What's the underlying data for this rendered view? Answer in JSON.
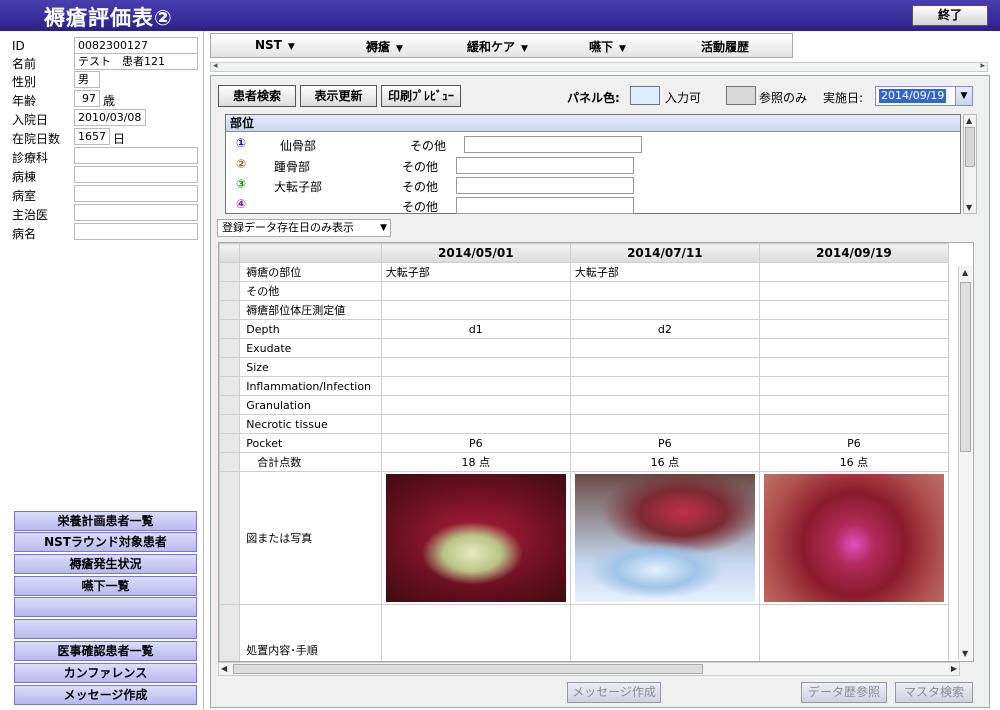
{
  "window": {
    "title": "褥瘡評価表②",
    "exit_label": "終了"
  },
  "patient": {
    "fields": [
      {
        "label": "ID",
        "value": "0082300127"
      },
      {
        "label": "名前",
        "value": "テスト　患者121"
      },
      {
        "label": "性別",
        "value": "男"
      },
      {
        "label": "年齢",
        "value": "97",
        "unit": "歳"
      },
      {
        "label": "入院日",
        "value": "2010/03/08"
      },
      {
        "label": "在院日数",
        "value": "1657",
        "unit": "日"
      },
      {
        "label": "診療科",
        "value": ""
      },
      {
        "label": "病棟",
        "value": ""
      },
      {
        "label": "病室",
        "value": ""
      },
      {
        "label": "主治医",
        "value": ""
      },
      {
        "label": "病名",
        "value": ""
      }
    ]
  },
  "left_nav": [
    "栄養計画患者一覧",
    "NSTラウンド対象患者",
    "褥瘡発生状況",
    "嚥下一覧",
    "",
    "",
    "医事確認患者一覧",
    "カンファレンス",
    "メッセージ作成"
  ],
  "menu": [
    {
      "label": "NST",
      "caret": "▼"
    },
    {
      "label": "褥瘡",
      "caret": "▼"
    },
    {
      "label": "緩和ケア",
      "caret": "▼"
    },
    {
      "label": "嚥下",
      "caret": "▼"
    },
    {
      "label": "活動履歴",
      "caret": ""
    }
  ],
  "toolbar": {
    "patient_search": "患者検索",
    "refresh": "表示更新",
    "print_preview": "印刷ﾌﾟﾚﾋﾞｭｰ",
    "panel_color_label": "パネル色:",
    "editable_label": "入力可",
    "readonly_label": "参照のみ",
    "date_label": "実施日:",
    "date_value": "2014/09/19",
    "editable_color": "#ddeeff",
    "readonly_color": "#d8d8d8"
  },
  "sites": {
    "header": "部位",
    "items": [
      {
        "num": "①",
        "name": "仙骨部",
        "other": "その他",
        "color": "#1a1aa8"
      },
      {
        "num": "②",
        "name": "踵骨部",
        "other": "その他",
        "color": "#c06000"
      },
      {
        "num": "③",
        "name": "大転子部",
        "other": "その他",
        "color": "#119911"
      },
      {
        "num": "④",
        "name": "",
        "other": "その他",
        "color": "#8a1a9a"
      }
    ]
  },
  "filter": {
    "value": "登録データ存在日のみ表示",
    "caret": "▼"
  },
  "grid": {
    "dates": [
      "2014/05/01",
      "2014/07/11",
      "2014/09/19"
    ],
    "rows": [
      {
        "label": "褥瘡の部位",
        "align": "l",
        "values": [
          "大転子部",
          "大転子部",
          ""
        ]
      },
      {
        "label": "その他",
        "align": "c",
        "values": [
          "",
          "",
          ""
        ]
      },
      {
        "label": "褥瘡部位体圧測定値",
        "align": "c",
        "values": [
          "",
          "",
          ""
        ]
      },
      {
        "label": "Depth",
        "align": "c",
        "values": [
          "d1",
          "d2",
          ""
        ]
      },
      {
        "label": "Exudate",
        "align": "c",
        "values": [
          "",
          "",
          ""
        ]
      },
      {
        "label": "Size",
        "align": "c",
        "values": [
          "",
          "",
          ""
        ]
      },
      {
        "label": "Inflammation/Infection",
        "align": "c",
        "values": [
          "",
          "",
          ""
        ]
      },
      {
        "label": "Granulation",
        "align": "c",
        "values": [
          "",
          "",
          ""
        ]
      },
      {
        "label": "Necrotic tissue",
        "align": "c",
        "values": [
          "",
          "",
          ""
        ]
      },
      {
        "label": "Pocket",
        "align": "c",
        "values": [
          "P6",
          "P6",
          "P6"
        ]
      },
      {
        "label": "　合計点数",
        "align": "c",
        "values": [
          "18 点",
          "16 点",
          "16 点"
        ]
      }
    ],
    "photo_label": "図または写真",
    "procedure_label": "処置内容･手順"
  },
  "bottom_buttons": {
    "message": "メッセージ作成",
    "history": "データ歴参照",
    "master": "マスタ検索"
  }
}
